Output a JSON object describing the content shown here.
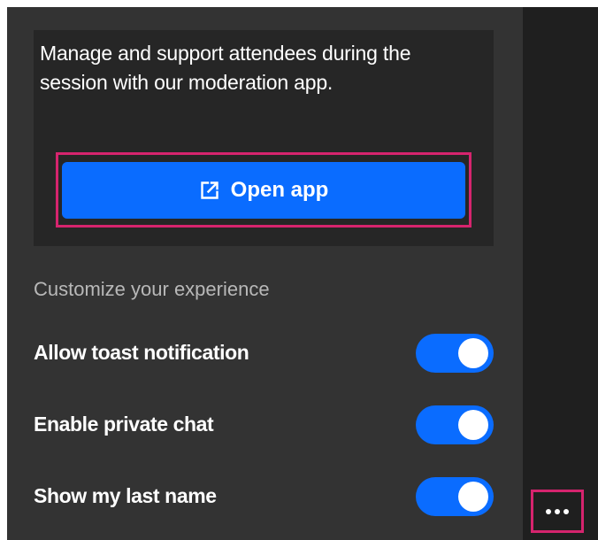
{
  "moderation": {
    "description": "Manage and support attendees during the session with our moderation app.",
    "open_app_label": "Open app",
    "open_app_icon": "external-link-icon"
  },
  "customize": {
    "heading": "Customize your experience",
    "settings": [
      {
        "label": "Allow toast notification",
        "enabled": true
      },
      {
        "label": "Enable private chat",
        "enabled": true
      },
      {
        "label": "Show my last name",
        "enabled": true
      }
    ]
  },
  "more_button": {
    "icon": "more-horizontal-icon"
  },
  "colors": {
    "accent": "#0a6cff",
    "highlight": "#d6246e",
    "panel_bg": "#333333",
    "card_bg": "#262626",
    "side_bg": "#1f1f1f"
  }
}
